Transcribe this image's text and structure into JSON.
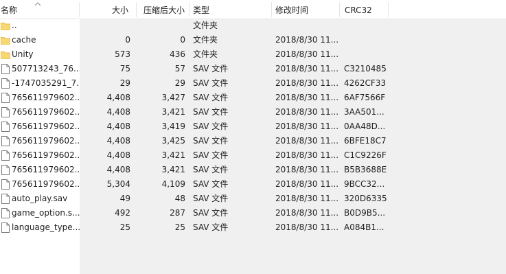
{
  "columns": {
    "name": "名称",
    "size": "大小",
    "compressed": "压缩后大小",
    "type": "类型",
    "modified": "修改时间",
    "crc": "CRC32"
  },
  "rows": [
    {
      "icon": "folder-icon",
      "name": "..",
      "size": "",
      "compressed": "",
      "type": "文件夹",
      "modified": "",
      "crc": ""
    },
    {
      "icon": "folder-icon",
      "name": "cache",
      "size": "0",
      "compressed": "0",
      "type": "文件夹",
      "modified": "2018/8/30 11...",
      "crc": ""
    },
    {
      "icon": "folder-icon",
      "name": "Unity",
      "size": "573",
      "compressed": "436",
      "type": "文件夹",
      "modified": "2018/8/30 11...",
      "crc": ""
    },
    {
      "icon": "file-icon",
      "name": "507713243_76...",
      "size": "75",
      "compressed": "57",
      "type": "SAV 文件",
      "modified": "2018/8/30 11...",
      "crc": "C3210485"
    },
    {
      "icon": "file-icon",
      "name": "-1747035291_7...",
      "size": "29",
      "compressed": "29",
      "type": "SAV 文件",
      "modified": "2018/8/30 11...",
      "crc": "4262CF33"
    },
    {
      "icon": "file-icon",
      "name": "765611979602...",
      "size": "4,408",
      "compressed": "3,427",
      "type": "SAV 文件",
      "modified": "2018/8/30 11...",
      "crc": "6AF7566F"
    },
    {
      "icon": "file-icon",
      "name": "765611979602...",
      "size": "4,408",
      "compressed": "3,421",
      "type": "SAV 文件",
      "modified": "2018/8/30 11...",
      "crc": "3AA501..."
    },
    {
      "icon": "file-icon",
      "name": "765611979602...",
      "size": "4,408",
      "compressed": "3,419",
      "type": "SAV 文件",
      "modified": "2018/8/30 11...",
      "crc": "0AA48D..."
    },
    {
      "icon": "file-icon",
      "name": "765611979602...",
      "size": "4,408",
      "compressed": "3,425",
      "type": "SAV 文件",
      "modified": "2018/8/30 11...",
      "crc": "6BFE18C7"
    },
    {
      "icon": "file-icon",
      "name": "765611979602...",
      "size": "4,408",
      "compressed": "3,421",
      "type": "SAV 文件",
      "modified": "2018/8/30 11...",
      "crc": "C1C9226F"
    },
    {
      "icon": "file-icon",
      "name": "765611979602...",
      "size": "4,408",
      "compressed": "3,421",
      "type": "SAV 文件",
      "modified": "2018/8/30 11...",
      "crc": "B5B3688E"
    },
    {
      "icon": "file-icon",
      "name": "765611979602...",
      "size": "5,304",
      "compressed": "4,109",
      "type": "SAV 文件",
      "modified": "2018/8/30 11...",
      "crc": "9BCC32..."
    },
    {
      "icon": "file-icon",
      "name": "auto_play.sav",
      "size": "49",
      "compressed": "48",
      "type": "SAV 文件",
      "modified": "2018/8/30 11...",
      "crc": "320D6335"
    },
    {
      "icon": "file-icon",
      "name": "game_option.s...",
      "size": "492",
      "compressed": "287",
      "type": "SAV 文件",
      "modified": "2018/8/30 11...",
      "crc": "B0D9B5..."
    },
    {
      "icon": "file-icon",
      "name": "language_type...",
      "size": "25",
      "compressed": "25",
      "type": "SAV 文件",
      "modified": "2018/8/30 11...",
      "crc": "A084B1..."
    }
  ],
  "colors": {
    "folder": "#f8d775",
    "folder_dark": "#e8b84a",
    "file_border": "#7a7a7a",
    "separator": "#e5e5e5",
    "empty_area": "#f0f0f0"
  }
}
